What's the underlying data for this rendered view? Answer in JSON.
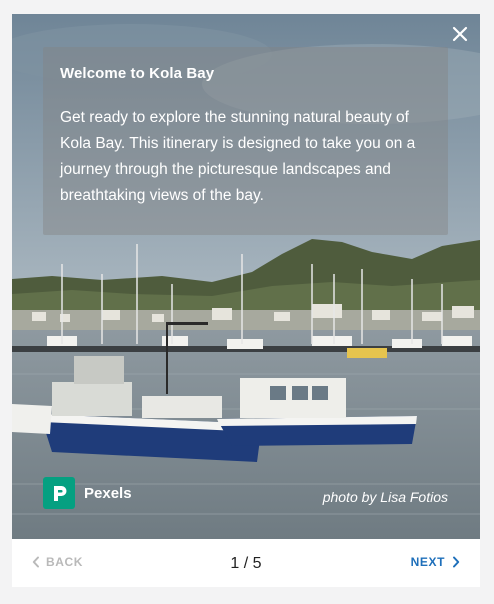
{
  "dialog": {
    "intro_title": "Welcome to Kola Bay",
    "intro_body": "Get ready to explore the stunning natural beauty of Kola Bay. This itinerary is designed to take you on a journey through the picturesque landscapes and breathtaking views of the bay.",
    "brand_name": "Pexels",
    "photo_credit": "photo by Lisa Fotios"
  },
  "footer": {
    "back_label": "BACK",
    "next_label": "NEXT",
    "page_indicator": "1 / 5"
  },
  "colors": {
    "accent": "#1e6fba",
    "disabled": "#b9b9b9",
    "brand": "#05a081"
  },
  "icons": {
    "close": "close-icon",
    "back": "chevron-left-icon",
    "next": "chevron-right-icon",
    "brand": "pexels-logo-icon"
  }
}
